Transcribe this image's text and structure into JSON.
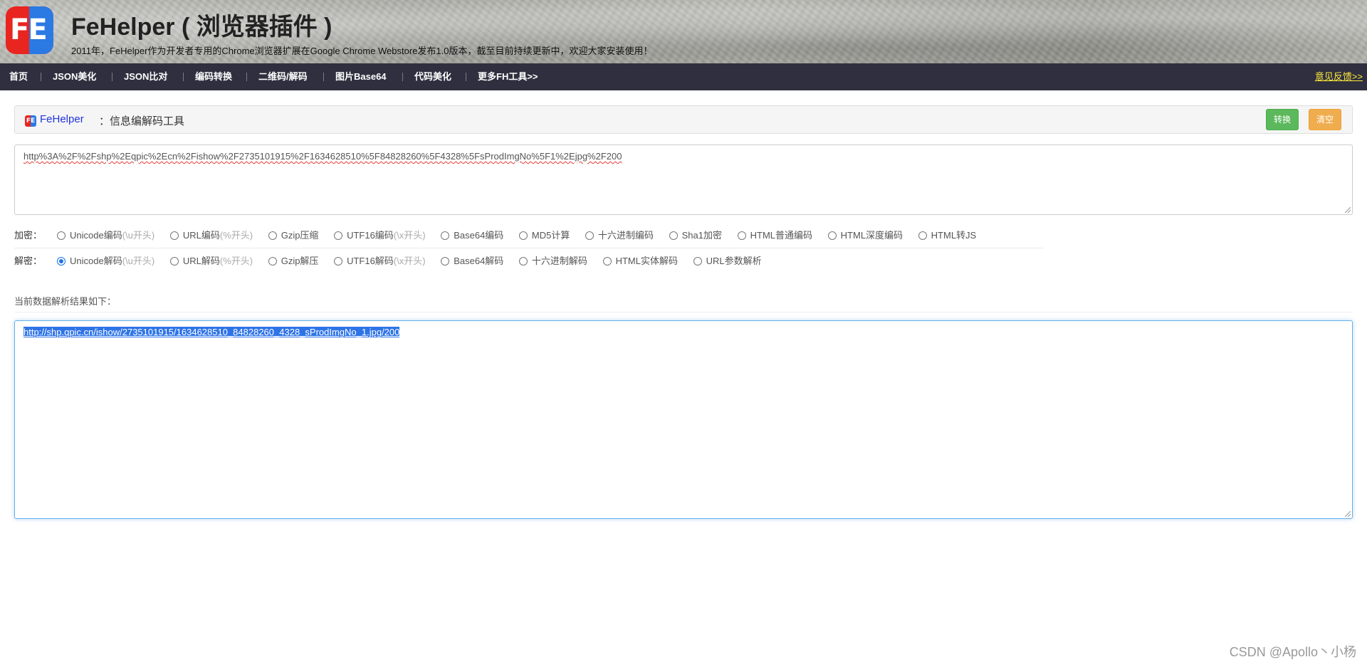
{
  "header": {
    "logo_text": "FE",
    "title": "FeHelper ( 浏览器插件 )",
    "subtitle": "2011年，FeHelper作为开发者专用的Chrome浏览器扩展在Google Chrome Webstore发布1.0版本，截至目前持续更新中，欢迎大家安装使用！"
  },
  "nav": {
    "items": [
      "首页",
      "JSON美化",
      "JSON比对",
      "编码转换",
      "二维码/解码",
      "图片Base64",
      "代码美化",
      "更多FH工具>>"
    ],
    "feedback": "意见反馈>>"
  },
  "panel": {
    "brand": "FeHelper",
    "tool_name": "：信息编解码工具",
    "convert_button": "转换",
    "clear_button": "清空"
  },
  "source": {
    "value": "http%3A%2F%2Fshp%2Eqpic%2Ecn%2Fishow%2F2735101915%2F1634628510%5F84828260%5F4328%5FsProdImgNo%5F1%2Ejpg%2F200"
  },
  "encode": {
    "label": "加密：",
    "options": [
      {
        "text": "Unicode编码",
        "hint": "(\\u开头)"
      },
      {
        "text": "URL编码",
        "hint": "(%开头)"
      },
      {
        "text": "Gzip压缩",
        "hint": ""
      },
      {
        "text": "UTF16编码",
        "hint": "(\\x开头)"
      },
      {
        "text": "Base64编码",
        "hint": ""
      },
      {
        "text": "MD5计算",
        "hint": ""
      },
      {
        "text": "十六进制编码",
        "hint": ""
      },
      {
        "text": "Sha1加密",
        "hint": ""
      },
      {
        "text": "HTML普通编码",
        "hint": ""
      },
      {
        "text": "HTML深度编码",
        "hint": ""
      },
      {
        "text": "HTML转JS",
        "hint": ""
      }
    ]
  },
  "decode": {
    "label": "解密：",
    "selected": "Unicode解码",
    "options": [
      {
        "text": "Unicode解码",
        "hint": "(\\u开头)"
      },
      {
        "text": "URL解码",
        "hint": "(%开头)"
      },
      {
        "text": "Gzip解压",
        "hint": ""
      },
      {
        "text": "UTF16解码",
        "hint": "(\\x开头)"
      },
      {
        "text": "Base64解码",
        "hint": ""
      },
      {
        "text": "十六进制解码",
        "hint": ""
      },
      {
        "text": "HTML实体解码",
        "hint": ""
      },
      {
        "text": "URL参数解析",
        "hint": ""
      }
    ]
  },
  "result": {
    "label": "当前数据解析结果如下：",
    "value": "http://shp.qpic.cn/ishow/2735101915/1634628510_84828260_4328_sProdImgNo_1.jpg/200"
  },
  "watermark": "CSDN @Apollo丶小杨",
  "colors": {
    "navbar_bg": "#2f2f3f",
    "feedback": "#ffeb3b",
    "convert_button": "#5cb85c",
    "clear_button": "#f0ad4e",
    "brand_link": "#2233dd",
    "selection": "#2f74e6"
  }
}
